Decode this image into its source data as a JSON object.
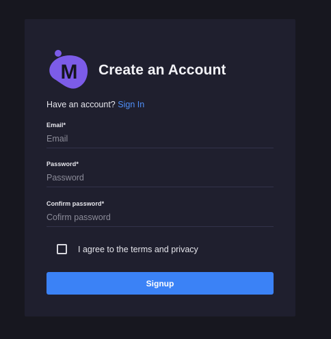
{
  "header": {
    "logo_letter": "M",
    "title": "Create an Account"
  },
  "signin_prompt": {
    "text": "Have an account?",
    "link_label": "Sign In"
  },
  "form": {
    "email": {
      "label": "Email*",
      "placeholder": "Email",
      "value": ""
    },
    "password": {
      "label": "Password*",
      "placeholder": "Password",
      "value": ""
    },
    "confirm_password": {
      "label": "Confirm password*",
      "placeholder": "Cofirm password",
      "value": ""
    },
    "agree": {
      "label": "I agree to the terms and privacy",
      "checked": false
    },
    "submit_label": "Signup"
  },
  "colors": {
    "background": "#17171f",
    "card": "#1f1f2e",
    "accent": "#3b82f6",
    "link": "#4f8ff7",
    "logo": "#7c5ce8"
  }
}
